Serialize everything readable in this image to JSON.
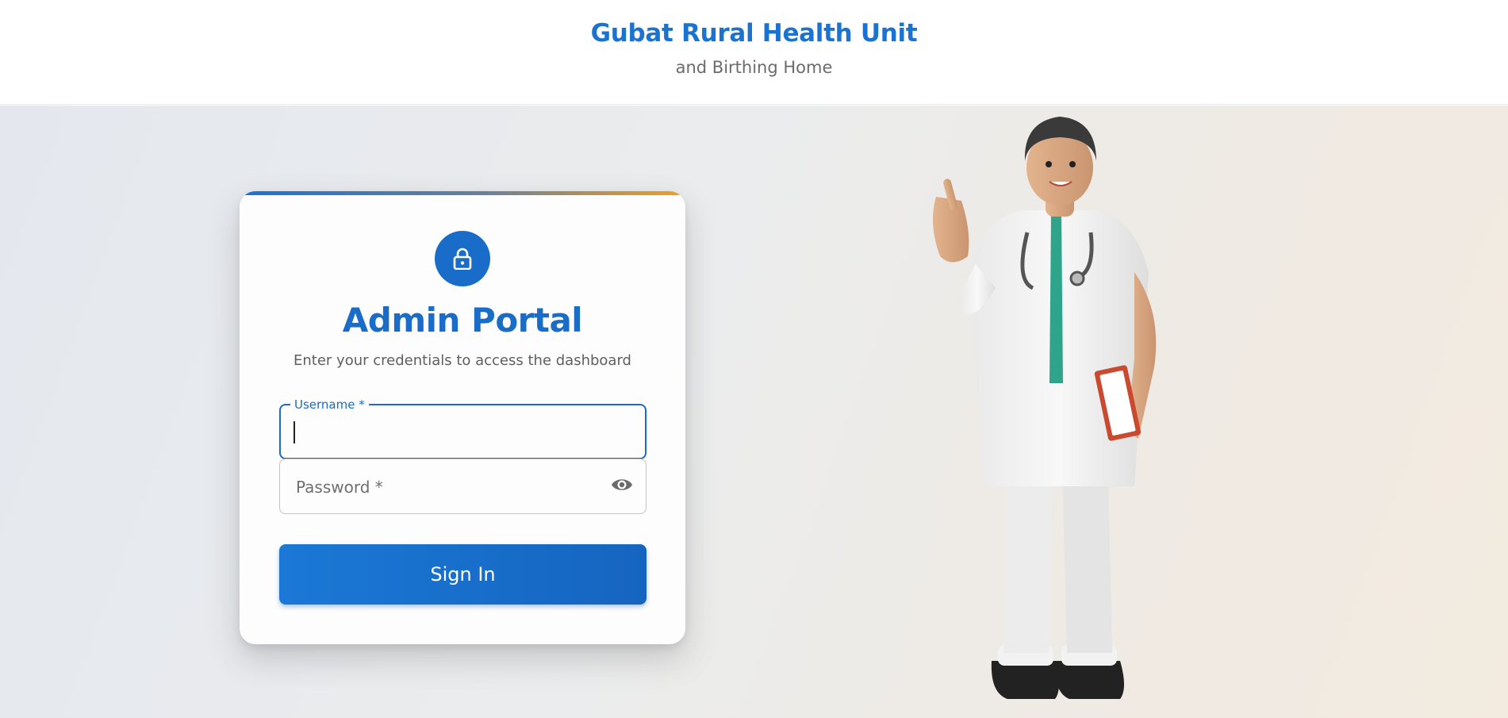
{
  "header": {
    "title": "Gubat Rural Health Unit",
    "subtitle": "and Birthing Home"
  },
  "login": {
    "title": "Admin Portal",
    "subtitle": "Enter your credentials to access the dashboard",
    "username": {
      "label": "Username *",
      "value": ""
    },
    "password": {
      "placeholder": "Password *",
      "value": ""
    },
    "submit_label": "Sign In"
  },
  "icons": {
    "card_icon": "lock-icon",
    "password_toggle": "eye-icon",
    "illustration": "doctor-illustration"
  },
  "colors": {
    "brand": "#1a73d0",
    "button": "#1565c0",
    "accent_orange": "#f0a020"
  }
}
